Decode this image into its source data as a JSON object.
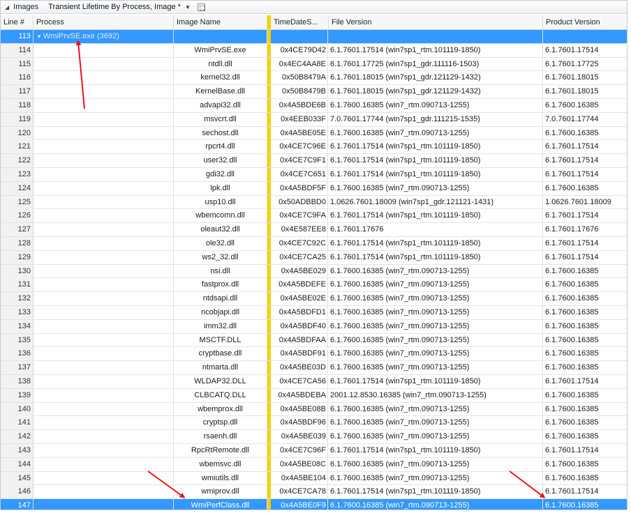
{
  "toolbar": {
    "tab_label": "Images",
    "view_name": "Transient Lifetime By Process, Image *"
  },
  "columns": {
    "line": "Line #",
    "process": "Process",
    "image": "Image Name",
    "timedate": "TimeDateS...",
    "file_version": "File Version",
    "product_version": "Product Version"
  },
  "rows": [
    {
      "line": "113",
      "process": "WmiPrvSE.exe (3692)",
      "image": "",
      "time": "",
      "fv": "",
      "pv": ""
    },
    {
      "line": "114",
      "process": "",
      "image": "WmiPrvSE.exe",
      "time": "0x4CE79D42",
      "fv": "6.1.7601.17514 (win7sp1_rtm.101119-1850)",
      "pv": "6.1.7601.17514"
    },
    {
      "line": "115",
      "process": "",
      "image": "ntdll.dll",
      "time": "0x4EC4AA8E",
      "fv": "6.1.7601.17725 (win7sp1_gdr.111116-1503)",
      "pv": "6.1.7601.17725"
    },
    {
      "line": "116",
      "process": "",
      "image": "kernel32.dll",
      "time": "0x50B8479A",
      "fv": "6.1.7601.18015 (win7sp1_gdr.121129-1432)",
      "pv": "6.1.7601.18015"
    },
    {
      "line": "117",
      "process": "",
      "image": "KernelBase.dll",
      "time": "0x50B8479B",
      "fv": "6.1.7601.18015 (win7sp1_gdr.121129-1432)",
      "pv": "6.1.7601.18015"
    },
    {
      "line": "118",
      "process": "",
      "image": "advapi32.dll",
      "time": "0x4A5BDE6B",
      "fv": "6.1.7600.16385 (win7_rtm.090713-1255)",
      "pv": "6.1.7600.16385"
    },
    {
      "line": "119",
      "process": "",
      "image": "msvcrt.dll",
      "time": "0x4EEB033F",
      "fv": "7.0.7601.17744 (win7sp1_gdr.111215-1535)",
      "pv": "7.0.7601.17744"
    },
    {
      "line": "120",
      "process": "",
      "image": "sechost.dll",
      "time": "0x4A5BE05E",
      "fv": "6.1.7600.16385 (win7_rtm.090713-1255)",
      "pv": "6.1.7600.16385"
    },
    {
      "line": "121",
      "process": "",
      "image": "rpcrt4.dll",
      "time": "0x4CE7C96E",
      "fv": "6.1.7601.17514 (win7sp1_rtm.101119-1850)",
      "pv": "6.1.7601.17514"
    },
    {
      "line": "122",
      "process": "",
      "image": "user32.dll",
      "time": "0x4CE7C9F1",
      "fv": "6.1.7601.17514 (win7sp1_rtm.101119-1850)",
      "pv": "6.1.7601.17514"
    },
    {
      "line": "123",
      "process": "",
      "image": "gdi32.dll",
      "time": "0x4CE7C651",
      "fv": "6.1.7601.17514 (win7sp1_rtm.101119-1850)",
      "pv": "6.1.7601.17514"
    },
    {
      "line": "124",
      "process": "",
      "image": "lpk.dll",
      "time": "0x4A5BDF5F",
      "fv": "6.1.7600.16385 (win7_rtm.090713-1255)",
      "pv": "6.1.7600.16385"
    },
    {
      "line": "125",
      "process": "",
      "image": "usp10.dll",
      "time": "0x50ADBBD0",
      "fv": "1.0626.7601.18009 (win7sp1_gdr.121121-1431)",
      "pv": "1.0626.7601.18009"
    },
    {
      "line": "126",
      "process": "",
      "image": "wbemcomn.dll",
      "time": "0x4CE7C9FA",
      "fv": "6.1.7601.17514 (win7sp1_rtm.101119-1850)",
      "pv": "6.1.7601.17514"
    },
    {
      "line": "127",
      "process": "",
      "image": "oleaut32.dll",
      "time": "0x4E587EE8",
      "fv": "6.1.7601.17676",
      "pv": "6.1.7601.17676"
    },
    {
      "line": "128",
      "process": "",
      "image": "ole32.dll",
      "time": "0x4CE7C92C",
      "fv": "6.1.7601.17514 (win7sp1_rtm.101119-1850)",
      "pv": "6.1.7601.17514"
    },
    {
      "line": "129",
      "process": "",
      "image": "ws2_32.dll",
      "time": "0x4CE7CA25",
      "fv": "6.1.7601.17514 (win7sp1_rtm.101119-1850)",
      "pv": "6.1.7601.17514"
    },
    {
      "line": "130",
      "process": "",
      "image": "nsi.dll",
      "time": "0x4A5BE029",
      "fv": "6.1.7600.16385 (win7_rtm.090713-1255)",
      "pv": "6.1.7600.16385"
    },
    {
      "line": "131",
      "process": "",
      "image": "fastprox.dll",
      "time": "0x4A5BDEFE",
      "fv": "6.1.7600.16385 (win7_rtm.090713-1255)",
      "pv": "6.1.7600.16385"
    },
    {
      "line": "132",
      "process": "",
      "image": "ntdsapi.dll",
      "time": "0x4A5BE02E",
      "fv": "6.1.7600.16385 (win7_rtm.090713-1255)",
      "pv": "6.1.7600.16385"
    },
    {
      "line": "133",
      "process": "",
      "image": "ncobjapi.dll",
      "time": "0x4A5BDFD1",
      "fv": "6.1.7600.16385 (win7_rtm.090713-1255)",
      "pv": "6.1.7600.16385"
    },
    {
      "line": "134",
      "process": "",
      "image": "imm32.dll",
      "time": "0x4A5BDF40",
      "fv": "6.1.7600.16385 (win7_rtm.090713-1255)",
      "pv": "6.1.7600.16385"
    },
    {
      "line": "135",
      "process": "",
      "image": "MSCTF.DLL",
      "time": "0x4A5BDFAA",
      "fv": "6.1.7600.16385 (win7_rtm.090713-1255)",
      "pv": "6.1.7600.16385"
    },
    {
      "line": "136",
      "process": "",
      "image": "cryptbase.dll",
      "time": "0x4A5BDF91",
      "fv": "6.1.7600.16385 (win7_rtm.090713-1255)",
      "pv": "6.1.7600.16385"
    },
    {
      "line": "137",
      "process": "",
      "image": "ntmarta.dll",
      "time": "0x4A5BE03D",
      "fv": "6.1.7600.16385 (win7_rtm.090713-1255)",
      "pv": "6.1.7600.16385"
    },
    {
      "line": "138",
      "process": "",
      "image": "WLDAP32.DLL",
      "time": "0x4CE7CA56",
      "fv": "6.1.7601.17514 (win7sp1_rtm.101119-1850)",
      "pv": "6.1.7601.17514"
    },
    {
      "line": "139",
      "process": "",
      "image": "CLBCATQ.DLL",
      "time": "0x4A5BDEBA",
      "fv": "2001.12.8530.16385 (win7_rtm.090713-1255)",
      "pv": "6.1.7600.16385"
    },
    {
      "line": "140",
      "process": "",
      "image": "wbemprox.dll",
      "time": "0x4A5BE08B",
      "fv": "6.1.7600.16385 (win7_rtm.090713-1255)",
      "pv": "6.1.7600.16385"
    },
    {
      "line": "141",
      "process": "",
      "image": "cryptsp.dll",
      "time": "0x4A5BDF96",
      "fv": "6.1.7600.16385 (win7_rtm.090713-1255)",
      "pv": "6.1.7600.16385"
    },
    {
      "line": "142",
      "process": "",
      "image": "rsaenh.dll",
      "time": "0x4A5BE039",
      "fv": "6.1.7600.16385 (win7_rtm.090713-1255)",
      "pv": "6.1.7600.16385"
    },
    {
      "line": "143",
      "process": "",
      "image": "RpcRtRemote.dll",
      "time": "0x4CE7C96F",
      "fv": "6.1.7601.17514 (win7sp1_rtm.101119-1850)",
      "pv": "6.1.7601.17514"
    },
    {
      "line": "144",
      "process": "",
      "image": "wbemsvc.dll",
      "time": "0x4A5BE08C",
      "fv": "6.1.7600.16385 (win7_rtm.090713-1255)",
      "pv": "6.1.7600.16385"
    },
    {
      "line": "145",
      "process": "",
      "image": "wmiutils.dll",
      "time": "0x4A5BE104",
      "fv": "6.1.7600.16385 (win7_rtm.090713-1255)",
      "pv": "6.1.7600.16385"
    },
    {
      "line": "146",
      "process": "",
      "image": "wmiprov.dll",
      "time": "0x4CE7CA78",
      "fv": "6.1.7601.17514 (win7sp1_rtm.101119-1850)",
      "pv": "6.1.7601.17514"
    },
    {
      "line": "147",
      "process": "",
      "image": "WmiPerfClass.dll",
      "time": "0x4A5BE0F9",
      "fv": "6.1.7600.16385 (win7_rtm.090713-1255)",
      "pv": "6.1.7600.16385"
    }
  ],
  "selected_lines": [
    "113",
    "147"
  ],
  "colors": {
    "selection": "#3399ff",
    "column_separator": "#f6d100",
    "arrow": "#e8141b"
  }
}
